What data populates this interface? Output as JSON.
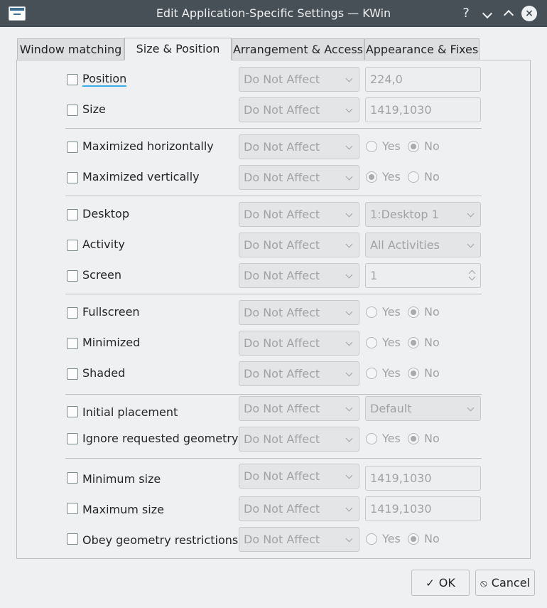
{
  "window": {
    "title": "Edit Application-Specific Settings — KWin"
  },
  "titlebar_buttons": {
    "help": "?",
    "close": "×"
  },
  "tabs": [
    {
      "label": "Window matching"
    },
    {
      "label": "Size & Position"
    },
    {
      "label": "Arrangement & Access"
    },
    {
      "label": "Appearance & Fixes"
    }
  ],
  "active_tab": "Size & Position",
  "rules": {
    "policy": "Do Not Affect",
    "position": {
      "label": "Position",
      "value": "224,0"
    },
    "size": {
      "label": "Size",
      "value": "1419,1030"
    },
    "max_horiz": {
      "label": "Maximized horizontally",
      "yes": "Yes",
      "no": "No",
      "selected": "No"
    },
    "max_vert": {
      "label": "Maximized vertically",
      "yes": "Yes",
      "no": "No",
      "selected": "Yes"
    },
    "desktop": {
      "label": "Desktop",
      "value": "1:Desktop 1"
    },
    "activity": {
      "label": "Activity",
      "value": "All Activities"
    },
    "screen": {
      "label": "Screen",
      "value": "1"
    },
    "fullscreen": {
      "label": "Fullscreen",
      "yes": "Yes",
      "no": "No",
      "selected": "No"
    },
    "minimized": {
      "label": "Minimized",
      "yes": "Yes",
      "no": "No",
      "selected": "No"
    },
    "shaded": {
      "label": "Shaded",
      "yes": "Yes",
      "no": "No",
      "selected": "No"
    },
    "initial_placement": {
      "label": "Initial placement",
      "value": "Default"
    },
    "ignore_geometry": {
      "label": "Ignore requested geometry",
      "yes": "Yes",
      "no": "No",
      "selected": "No"
    },
    "min_size": {
      "label": "Minimum size",
      "value": "1419,1030"
    },
    "max_size": {
      "label": "Maximum size",
      "value": "1419,1030"
    },
    "obey_geometry": {
      "label": "Obey geometry restrictions",
      "yes": "Yes",
      "no": "No",
      "selected": "No"
    }
  },
  "buttons": {
    "ok": "OK",
    "cancel": "Cancel"
  },
  "colors": {
    "titlebar": "#475057",
    "background": "#eff0f1",
    "focus": "#3daee9"
  }
}
